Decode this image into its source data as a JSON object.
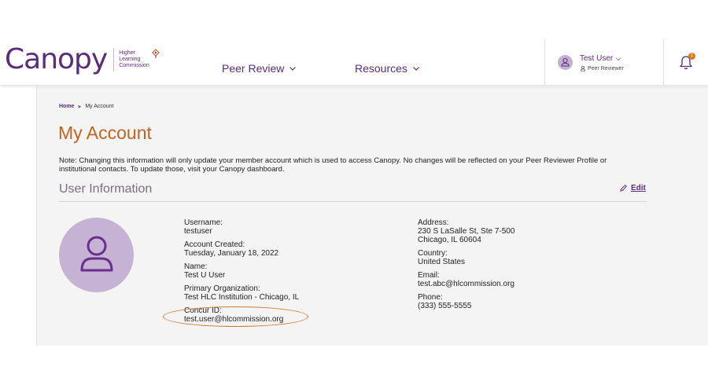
{
  "header": {
    "logo_text": "Canopy",
    "hlc_lines": [
      "Higher",
      "Learning",
      "Commission"
    ],
    "nav": [
      {
        "label": "Peer Review"
      },
      {
        "label": "Resources"
      }
    ],
    "user": {
      "name": "Test User",
      "role": "Peer Reviewer"
    },
    "notification_count": "1"
  },
  "breadcrumb": {
    "home": "Home",
    "current": "My Account"
  },
  "page_title": "My Account",
  "note": "Note: Changing this information will only update your member account which is used to access Canopy. No changes will be reflected on your Peer Reviewer Profile or institutional contacts. To update those, visit your Canopy dashboard.",
  "section": {
    "title": "User Information",
    "edit_label": "Edit"
  },
  "fields_left": [
    {
      "label": "Username:",
      "value": "testuser"
    },
    {
      "label": "Account Created:",
      "value": "Tuesday, January 18, 2022"
    },
    {
      "label": "Name:",
      "value": "Test U User"
    },
    {
      "label": "Primary Organization:",
      "value": "Test HLC Institution - Chicago, IL"
    },
    {
      "label": "Concur ID:",
      "value": "test.user@hlcommission.org"
    }
  ],
  "fields_right": [
    {
      "label": "Address:",
      "value_lines": [
        "230 S LaSalle St, Ste 7-500",
        "Chicago, IL 60604"
      ]
    },
    {
      "label": "Country:",
      "value_lines": [
        "United States"
      ]
    },
    {
      "label": "Email:",
      "value_lines": [
        "test.abc@hlcommission.org"
      ]
    },
    {
      "label": "Phone:",
      "value_lines": [
        "(333) 555-5555"
      ]
    }
  ],
  "colors": {
    "brand_purple": "#5b2b7e",
    "title_orange": "#c4631f",
    "highlight_orange": "#c97a2e",
    "avatar_lilac": "#c6b3d3"
  },
  "icons": [
    "chevron-down-icon",
    "user-icon",
    "bell-icon",
    "pencil-icon",
    "hlc-diamond-icon"
  ]
}
